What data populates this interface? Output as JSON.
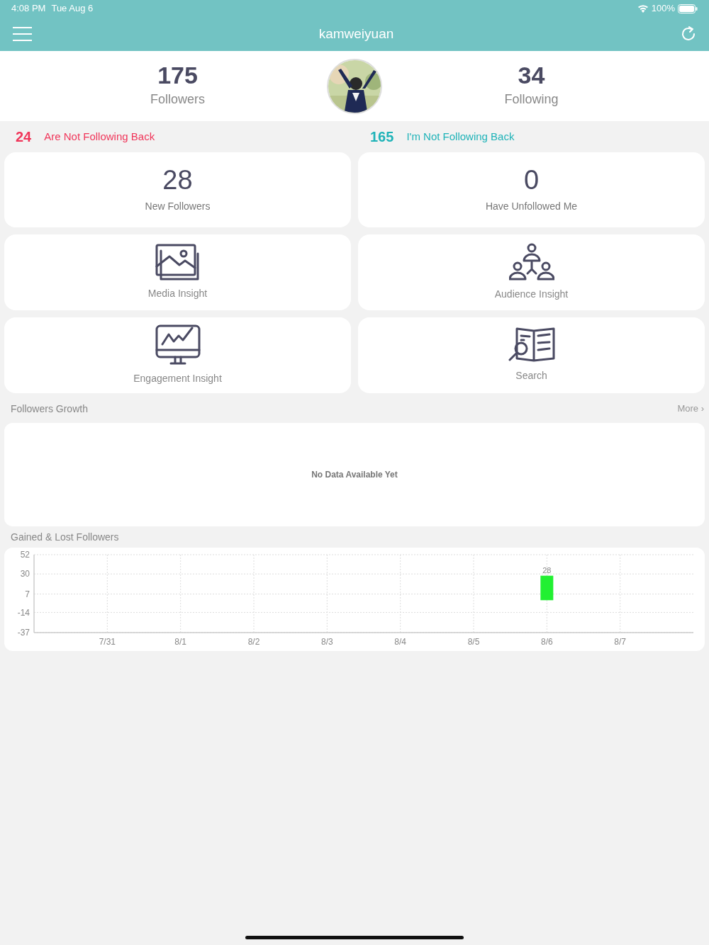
{
  "status_bar": {
    "time": "4:08 PM",
    "date": "Tue Aug 6",
    "battery": "100%"
  },
  "nav": {
    "title": "kamweiyuan"
  },
  "profile": {
    "followers": {
      "count": "175",
      "label": "Followers"
    },
    "following": {
      "count": "34",
      "label": "Following"
    }
  },
  "not_following": [
    {
      "count": "24",
      "label": "Are Not Following Back",
      "color": "#f0365a"
    },
    {
      "count": "165",
      "label": "I'm Not Following Back",
      "color": "#1fb3b8"
    }
  ],
  "stat_cards": [
    {
      "count": "28",
      "label": "New Followers"
    },
    {
      "count": "0",
      "label": "Have Unfollowed Me"
    }
  ],
  "insight_cards": [
    {
      "kind": "media",
      "label": "Media Insight"
    },
    {
      "kind": "audience",
      "label": "Audience Insight"
    },
    {
      "kind": "engagement",
      "label": "Engagement Insight"
    },
    {
      "kind": "search",
      "label": "Search"
    }
  ],
  "followers_growth": {
    "title": "Followers Growth",
    "more": "More ›",
    "empty_message": "No Data Available Yet"
  },
  "gained_lost": {
    "title": "Gained & Lost Followers",
    "chart_data": {
      "type": "bar",
      "categories": [
        "7/31",
        "8/1",
        "8/2",
        "8/3",
        "8/4",
        "8/5",
        "8/6",
        "8/7"
      ],
      "series": [
        {
          "color": "#22f032",
          "values": [
            null,
            null,
            null,
            null,
            null,
            null,
            28,
            null
          ]
        }
      ],
      "ylim": [
        -37,
        52
      ],
      "yticks": [
        52,
        30,
        7,
        -14,
        -37
      ],
      "data_labels": true,
      "grid": true
    }
  }
}
